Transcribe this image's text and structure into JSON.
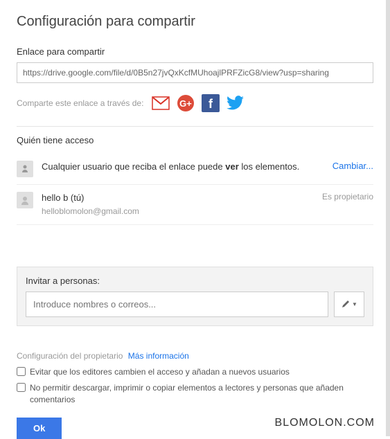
{
  "title": "Configuración para compartir",
  "linkSection": {
    "label": "Enlace para compartir",
    "url": "https://drive.google.com/file/d/0B5n27jvQxKcfMUhoajlPRFZicG8/view?usp=sharing",
    "shareText": "Comparte este enlace a través de:"
  },
  "accessSection": {
    "heading": "Quién tiene acceso",
    "public": {
      "text_a": "Cualquier usuario que reciba el enlace puede ",
      "text_bold": "ver",
      "text_b": " los elementos.",
      "action": "Cambiar..."
    },
    "owner": {
      "name": "hello b (tú)",
      "email": "helloblomolon@gmail.com",
      "role": "Es propietario"
    }
  },
  "invite": {
    "label": "Invitar a personas:",
    "placeholder": "Introduce nombres o correos..."
  },
  "ownerSettings": {
    "heading": "Configuración del propietario",
    "moreInfo": "Más información",
    "opt1": "Evitar que los editores cambien el acceso y añadan a nuevos usuarios",
    "opt2": "No permitir descargar, imprimir o copiar elementos a lectores y personas que añaden comentarios"
  },
  "okButton": "Ok",
  "watermark": "BLOMOLON.COM"
}
